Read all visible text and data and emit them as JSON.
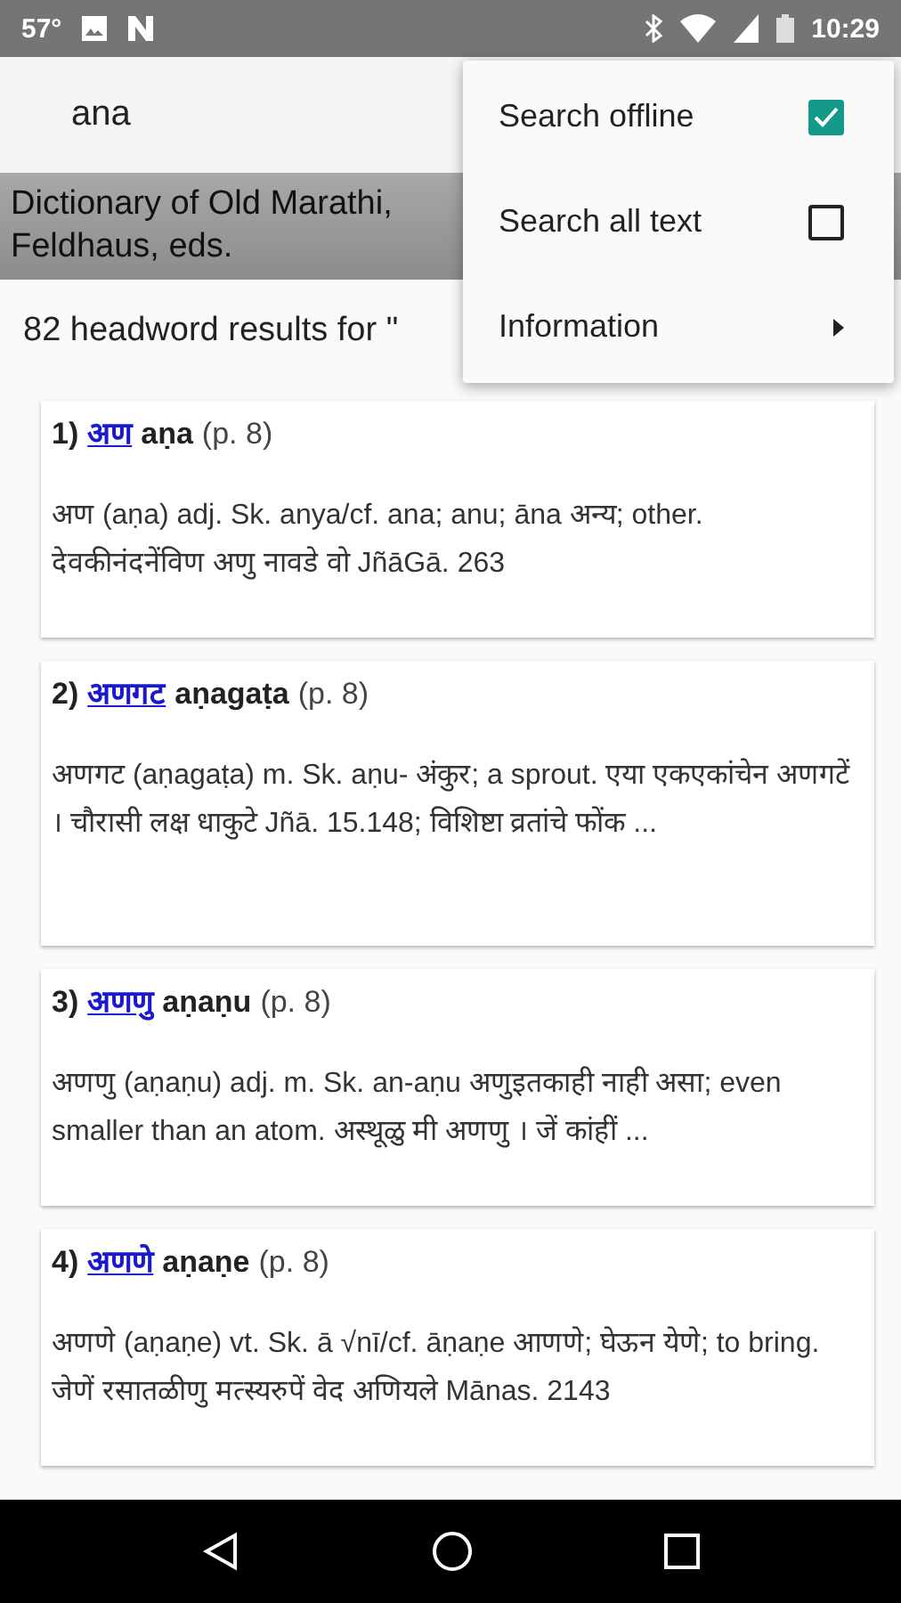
{
  "status_bar": {
    "temperature": "57°",
    "time": "10:29"
  },
  "search": {
    "value": "ana"
  },
  "banner": {
    "lines": [
      "Dictionary of Old Marathi,",
      "Feldhaus, eds."
    ]
  },
  "results_count": "82 headword results for \"",
  "results": [
    {
      "number": "1)",
      "headword": "अण",
      "transliteration": "aṇa",
      "page": "(p. 8)",
      "definition": "अण (aṇa) adj. Sk. anya/cf. ana; anu; āna अन्य; other. देवकीनंदनेंविण अणु नावडे वो JñāGā. 263"
    },
    {
      "number": "2)",
      "headword": "अणगट",
      "transliteration": "aṇagaṭa",
      "page": "(p. 8)",
      "definition": "अणगट (aṇagaṭa) m. Sk. aṇu- अंकुर; a sprout. एया एकएकांचेन अणगटें । चौरासी लक्ष धाकुटे Jñā. 15.148; विशिष्टा व्रतांचे फोंक ..."
    },
    {
      "number": "3)",
      "headword": "अणणु",
      "transliteration": "aṇaṇu",
      "page": "(p. 8)",
      "definition": "अणणु (aṇaṇu) adj. m. Sk. an-aṇu अणुइतकाही नाही असा; even smaller than an atom. अस्थूळु मी अणणु । जें कांहीं ..."
    },
    {
      "number": "4)",
      "headword": "अणणे",
      "transliteration": "aṇaṇe",
      "page": "(p. 8)",
      "definition": "अणणे (aṇaṇe) vt. Sk. ā √nī/cf. āṇaṇe आणणे; घेऊन येणे; to bring. जेणें रसातळीणु मत्स्यरुपें वेद अणियले Mānas. 2143"
    }
  ],
  "menu": [
    {
      "kind": "checkbox",
      "label": "Search offline",
      "checked": true
    },
    {
      "kind": "checkbox",
      "label": "Search all text",
      "checked": false
    },
    {
      "kind": "submenu",
      "label": "Information"
    }
  ]
}
